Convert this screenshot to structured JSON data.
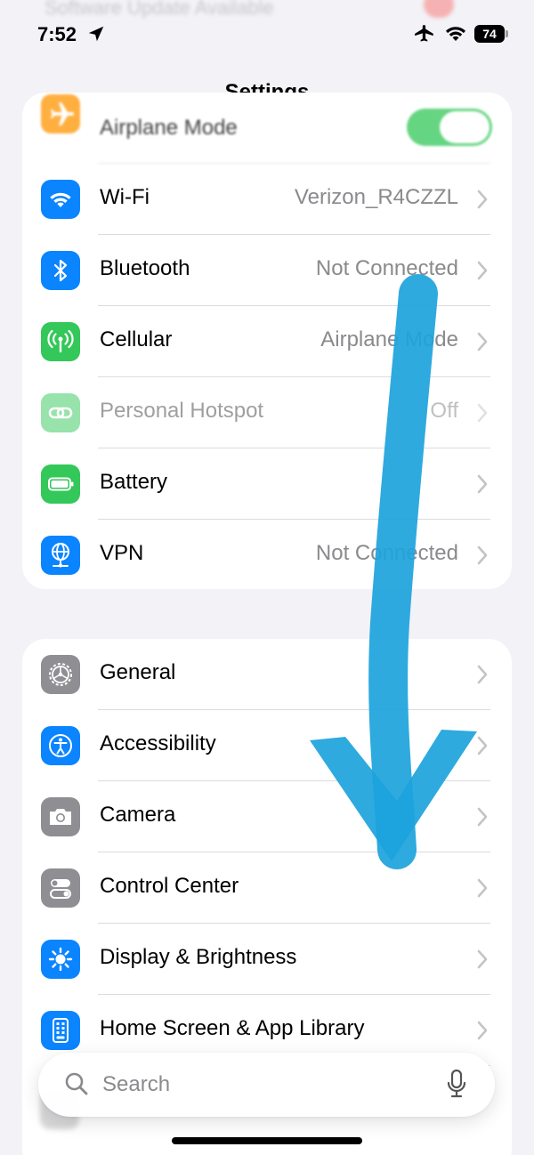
{
  "background_banner": {
    "text": "Software Update Available"
  },
  "status_bar": {
    "time": "7:52",
    "battery": "74",
    "icons": [
      "location-arrow-icon",
      "airplane-icon",
      "wifi-icon",
      "battery-icon"
    ]
  },
  "title": "Settings",
  "group1": [
    {
      "id": "airplane-mode",
      "label": "Airplane Mode",
      "toggle": true,
      "toggle_on": true,
      "icon": "airplane-icon",
      "color": "#ff9500"
    },
    {
      "id": "wifi",
      "label": "Wi-Fi",
      "value": "Verizon_R4CZZL",
      "icon": "wifi-icon",
      "color": "#0a84ff"
    },
    {
      "id": "bluetooth",
      "label": "Bluetooth",
      "value": "Not Connected",
      "icon": "bluetooth-icon",
      "color": "#0a84ff"
    },
    {
      "id": "cellular",
      "label": "Cellular",
      "value": "Airplane Mode",
      "icon": "cellular-antenna-icon",
      "color": "#34c759"
    },
    {
      "id": "personal-hotspot",
      "label": "Personal Hotspot",
      "value": "Off",
      "icon": "link-chain-icon",
      "color": "#34c759",
      "disabled": true
    },
    {
      "id": "battery",
      "label": "Battery",
      "value": "",
      "icon": "battery-icon",
      "color": "#34c759"
    },
    {
      "id": "vpn",
      "label": "VPN",
      "value": "Not Connected",
      "icon": "globe-network-icon",
      "color": "#0a84ff"
    }
  ],
  "group2": [
    {
      "id": "general",
      "label": "General",
      "icon": "gear-icon",
      "color": "#8e8e93"
    },
    {
      "id": "accessibility",
      "label": "Accessibility",
      "icon": "accessibility-person-icon",
      "color": "#0a84ff"
    },
    {
      "id": "camera",
      "label": "Camera",
      "icon": "camera-icon",
      "color": "#8e8e93"
    },
    {
      "id": "control-center",
      "label": "Control Center",
      "icon": "toggles-icon",
      "color": "#8e8e93"
    },
    {
      "id": "display-brightness",
      "label": "Display & Brightness",
      "icon": "sun-icon",
      "color": "#0a84ff"
    },
    {
      "id": "home-screen",
      "label": "Home Screen & App Library",
      "icon": "phone-grid-icon",
      "color": "#0a84ff"
    }
  ],
  "search": {
    "placeholder": "Search"
  },
  "colors": {
    "accent": "#0a84ff",
    "toggle_on": "#34c759",
    "annotation_arrow": "#1ca3dc"
  }
}
